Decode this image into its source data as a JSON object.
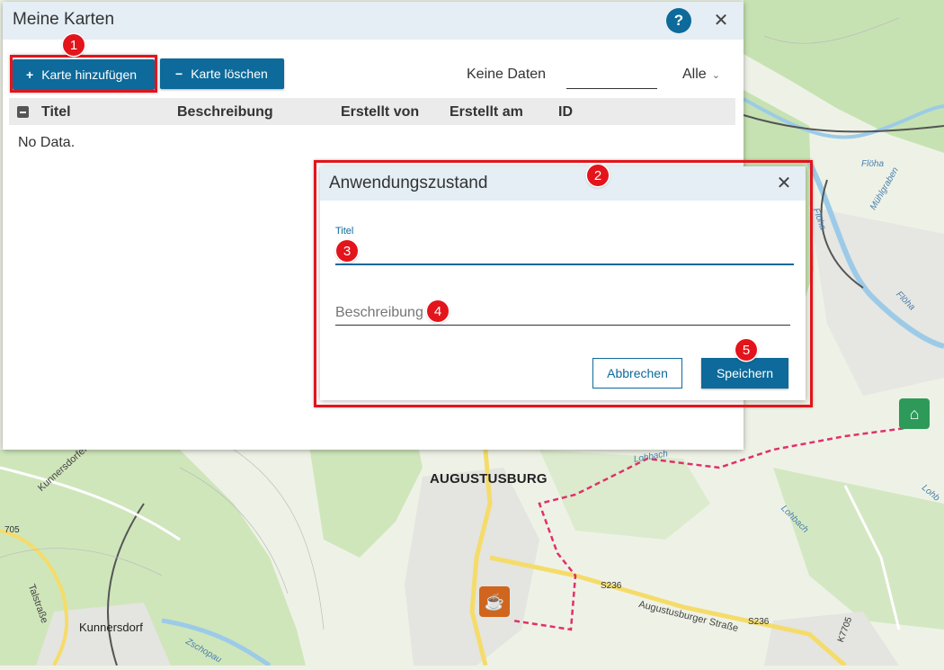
{
  "map": {
    "labels": {
      "town": "AUGUSTUSBURG",
      "village": "Kunnersdorf",
      "road_kunnersdorfer": "Kunnersdorfer Straße",
      "road_augustusburger": "Augustusburger Straße",
      "road_tal": "Talstraße",
      "road_s236_a": "S236",
      "road_s236_b": "S236",
      "road_k7705": "K7705",
      "road_705": "705",
      "river_floeha_a": "Flöha",
      "river_floeha_b": "Flöha",
      "river_floeha_c": "Flöha",
      "river_muehlgraben": "Mühlgraben",
      "river_lohbach_a": "Lohbach",
      "river_lohbach_b": "Lohbach",
      "river_lohbach_c": "Lohb",
      "river_zschopau": "Zschopau"
    },
    "colors": {
      "green": "#c6e2b2",
      "road_yellow": "#f5dc6a",
      "route_pink": "#e0306a",
      "river": "#9ccbe8"
    }
  },
  "main_panel": {
    "title": "Meine Karten",
    "help_label": "?",
    "close_label": "✕",
    "add_button": {
      "symbol": "+",
      "label": "Karte hinzufügen"
    },
    "delete_button": {
      "symbol": "−",
      "label": "Karte löschen"
    },
    "no_data_label": "Keine Daten",
    "filter_value": "",
    "select": {
      "value": "Alle",
      "icon": "chevron-down-icon"
    },
    "table": {
      "columns": [
        "Titel",
        "Beschreibung",
        "Erstellt von",
        "Erstellt am",
        "ID"
      ],
      "empty_text": "No Data."
    }
  },
  "dialog": {
    "title": "Anwendungszustand",
    "close_label": "✕",
    "title_field": {
      "label": "Titel",
      "value": ""
    },
    "description_field": {
      "placeholder": "Beschreibung",
      "value": ""
    },
    "cancel_label": "Abbrechen",
    "save_label": "Speichern"
  },
  "annotations": {
    "markers": [
      "1",
      "2",
      "3",
      "4",
      "5"
    ],
    "color": "#e3141b"
  }
}
